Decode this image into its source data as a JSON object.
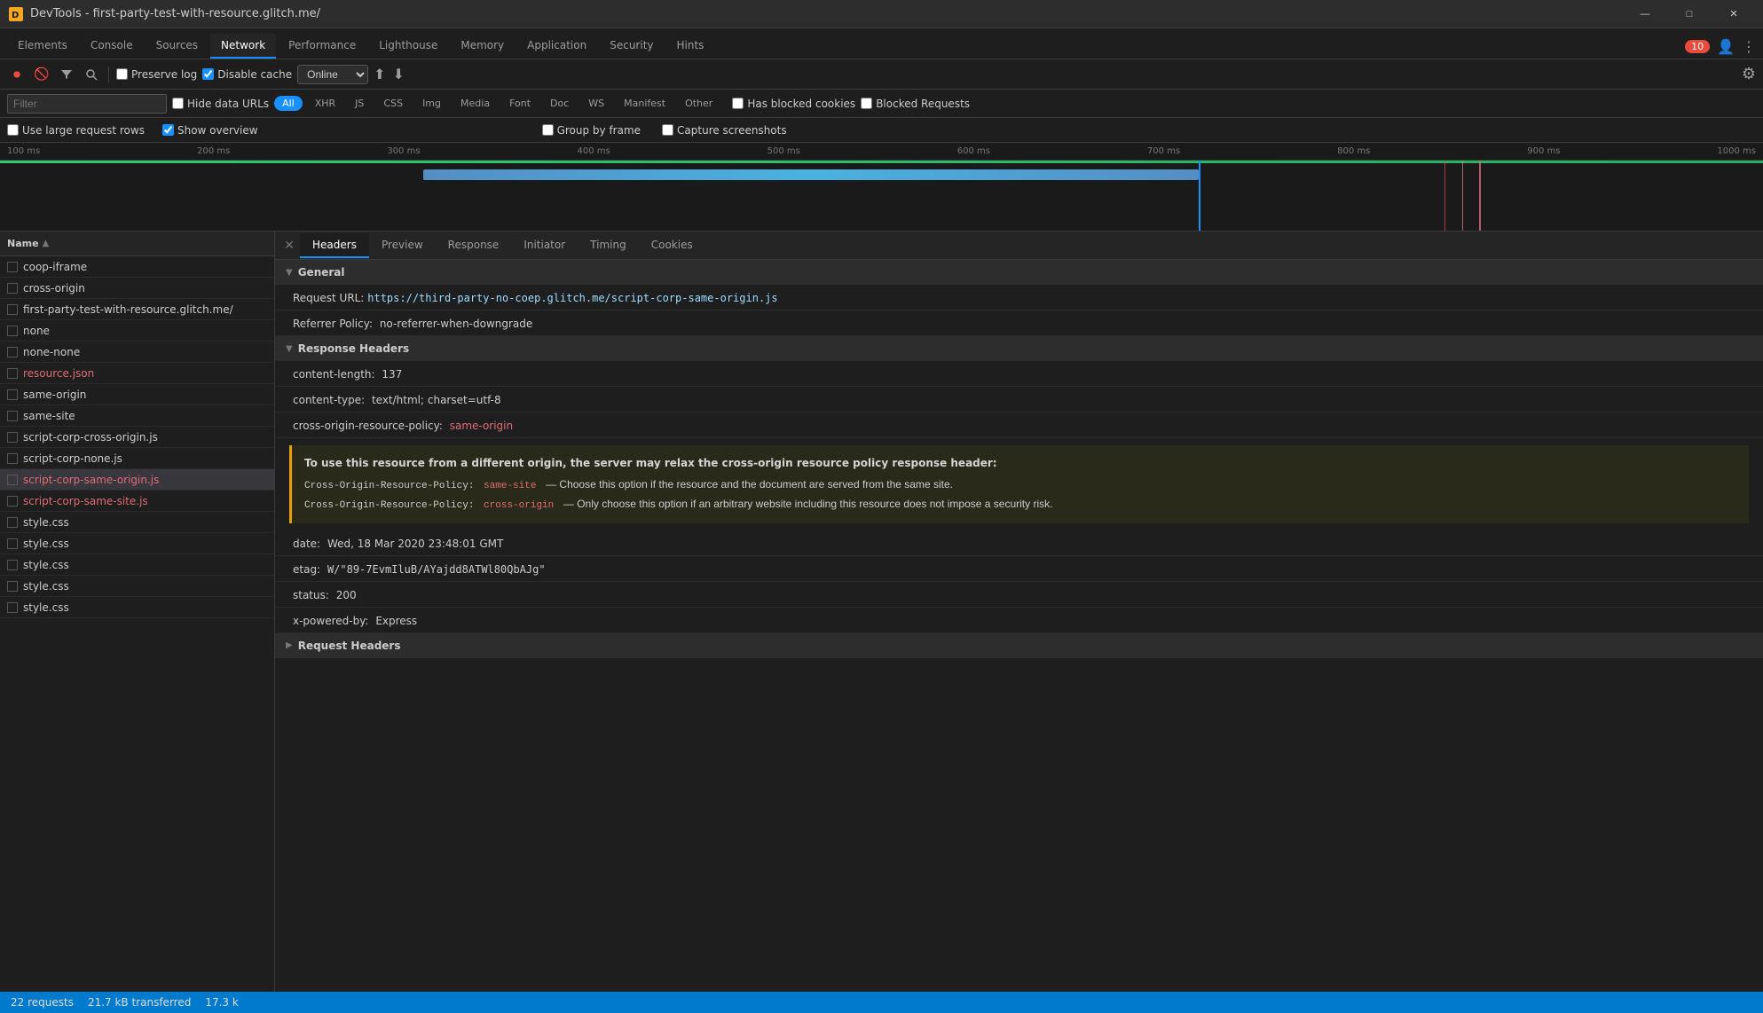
{
  "titleBar": {
    "icon": "⚙",
    "title": "DevTools - first-party-test-with-resource.glitch.me/",
    "minimize": "—",
    "maximize": "□",
    "close": "✕"
  },
  "tabs": {
    "items": [
      {
        "label": "Elements",
        "active": false
      },
      {
        "label": "Console",
        "active": false
      },
      {
        "label": "Sources",
        "active": false
      },
      {
        "label": "Network",
        "active": true
      },
      {
        "label": "Performance",
        "active": false
      },
      {
        "label": "Lighthouse",
        "active": false
      },
      {
        "label": "Memory",
        "active": false
      },
      {
        "label": "Application",
        "active": false
      },
      {
        "label": "Security",
        "active": false
      },
      {
        "label": "Hints",
        "active": false
      }
    ],
    "errorBadge": "10"
  },
  "toolbar": {
    "preserveLog": "Preserve log",
    "disableCache": "Disable cache",
    "online": "Online"
  },
  "filterBar": {
    "placeholder": "Filter",
    "hideDataUrls": "Hide data URLs",
    "filters": [
      "All",
      "XHR",
      "JS",
      "CSS",
      "Img",
      "Media",
      "Font",
      "Doc",
      "WS",
      "Manifest",
      "Other"
    ],
    "activeFilter": "All",
    "hasBlockedCookies": "Has blocked cookies",
    "blockedRequests": "Blocked Requests"
  },
  "optionsRow": {
    "useLargeRows": "Use large request rows",
    "showOverview": "Show overview",
    "groupByFrame": "Group by frame",
    "captureScreenshots": "Capture screenshots"
  },
  "timeline": {
    "markers": [
      "100 ms",
      "200 ms",
      "300 ms",
      "400 ms",
      "500 ms",
      "600 ms",
      "700 ms",
      "800 ms",
      "900 ms",
      "1000 ms"
    ]
  },
  "fileList": {
    "header": "Name",
    "items": [
      {
        "name": "coop-iframe",
        "red": false
      },
      {
        "name": "cross-origin",
        "red": false
      },
      {
        "name": "first-party-test-with-resource.glitch.me/",
        "red": false
      },
      {
        "name": "none",
        "red": false
      },
      {
        "name": "none-none",
        "red": false
      },
      {
        "name": "resource.json",
        "red": true
      },
      {
        "name": "same-origin",
        "red": false
      },
      {
        "name": "same-site",
        "red": false
      },
      {
        "name": "script-corp-cross-origin.js",
        "red": false
      },
      {
        "name": "script-corp-none.js",
        "red": false
      },
      {
        "name": "script-corp-same-origin.js",
        "red": true,
        "selected": true
      },
      {
        "name": "script-corp-same-site.js",
        "red": true
      },
      {
        "name": "style.css",
        "red": false
      },
      {
        "name": "style.css",
        "red": false
      },
      {
        "name": "style.css",
        "red": false
      },
      {
        "name": "style.css",
        "red": false
      },
      {
        "name": "style.css",
        "red": false
      }
    ]
  },
  "headersPanel": {
    "tabs": [
      "Headers",
      "Preview",
      "Response",
      "Initiator",
      "Timing",
      "Cookies"
    ],
    "activeTab": "Headers",
    "sections": {
      "general": {
        "title": "General",
        "requestUrl": {
          "key": "Request URL:",
          "value": "https://third-party-no-coep.glitch.me/script-corp-same-origin.js"
        },
        "referrerPolicy": {
          "key": "Referrer Policy:",
          "value": "no-referrer-when-downgrade"
        }
      },
      "responseHeaders": {
        "title": "Response Headers",
        "fields": [
          {
            "key": "content-length:",
            "value": "137"
          },
          {
            "key": "content-type:",
            "value": "text/html; charset=utf-8"
          },
          {
            "key": "cross-origin-resource-policy:",
            "value": "same-origin",
            "valueRed": true
          }
        ],
        "warning": {
          "title": "To use this resource from a different origin, the server may relax the cross-origin resource policy response header:",
          "lines": [
            {
              "prefix": "Cross-Origin-Resource-Policy:",
              "code": "same-site",
              "suffix": "— Choose this option if the resource and the document are served from the same site."
            },
            {
              "prefix": "Cross-Origin-Resource-Policy:",
              "code": "cross-origin",
              "suffix": "— Only choose this option if an arbitrary website including this resource does not impose a security risk."
            }
          ]
        },
        "moreFields": [
          {
            "key": "date:",
            "value": "Wed, 18 Mar 2020 23:48:01 GMT"
          },
          {
            "key": "etag:",
            "value": "W/\"89-7EvmIluB/AYajdd8ATWl80QbAJg\""
          },
          {
            "key": "status:",
            "value": "200"
          },
          {
            "key": "x-powered-by:",
            "value": "Express"
          }
        ]
      },
      "requestHeaders": {
        "title": "Request Headers"
      }
    }
  },
  "statusBar": {
    "requests": "22 requests",
    "transferred": "21.7 kB transferred",
    "size": "17.3 k"
  }
}
